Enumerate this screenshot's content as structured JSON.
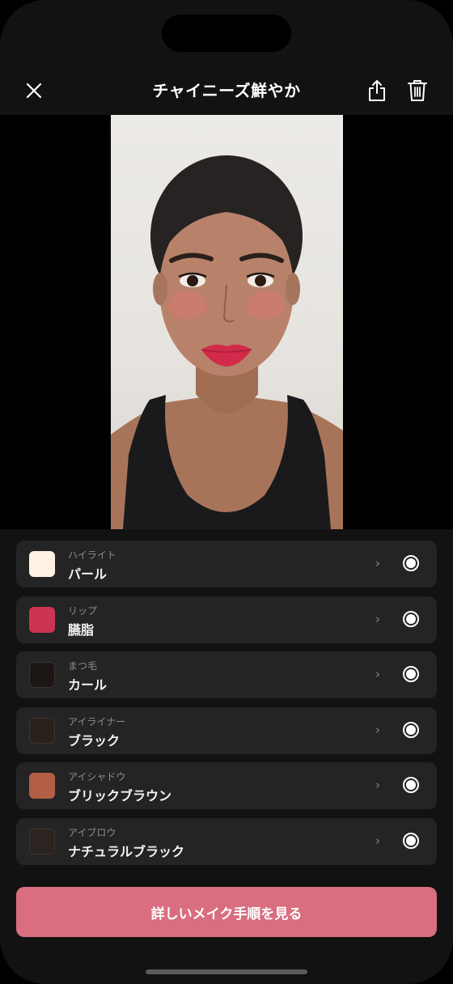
{
  "header": {
    "title": "チャイニーズ鮮やか",
    "close_icon": "close-icon",
    "share_icon": "share-icon",
    "trash_icon": "trash-icon"
  },
  "items": [
    {
      "category": "ハイライト",
      "value": "パール",
      "swatch": "#fff1e3"
    },
    {
      "category": "リップ",
      "value": "臙脂",
      "swatch": "#cc3452"
    },
    {
      "category": "まつ毛",
      "value": "カール",
      "swatch": "#1c1715"
    },
    {
      "category": "アイライナー",
      "value": "ブラック",
      "swatch": "#2a211d"
    },
    {
      "category": "アイシャドウ",
      "value": "ブリックブラウン",
      "swatch": "#b35f47"
    },
    {
      "category": "アイブロウ",
      "value": "ナチュラルブラック",
      "swatch": "#2b2420"
    }
  ],
  "cta_label": "詳しいメイク手順を見る",
  "colors": {
    "background": "#121212",
    "row_bg": "#242424",
    "accent": "#d86e7f"
  }
}
